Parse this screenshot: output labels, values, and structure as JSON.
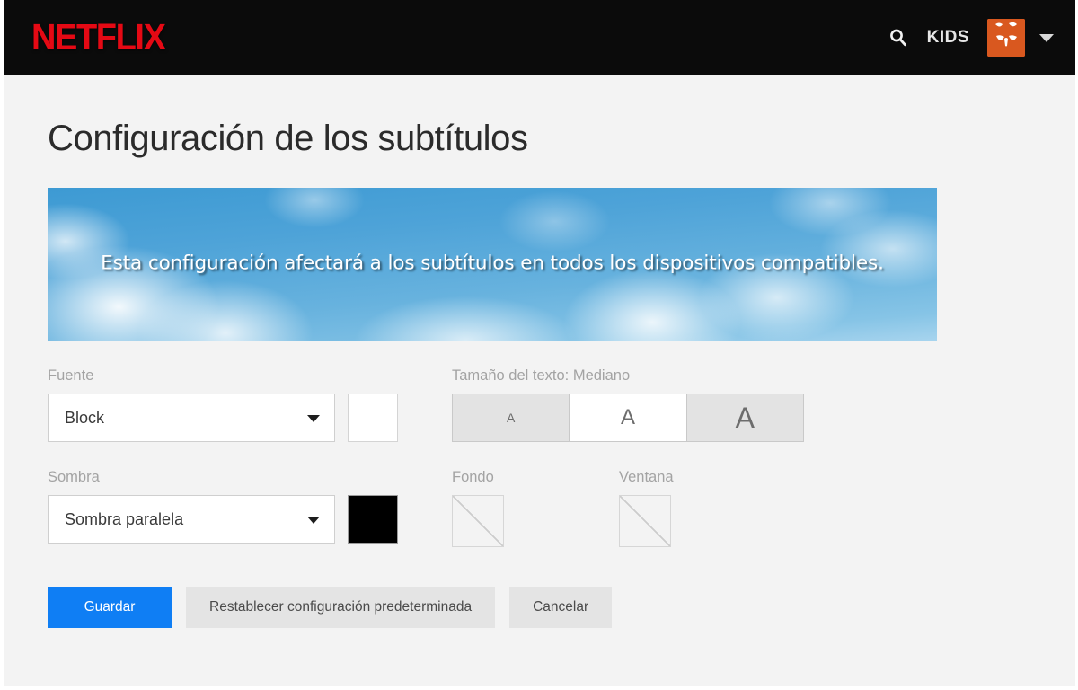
{
  "header": {
    "logo": "NETFLIX",
    "search_icon": "search-icon",
    "kids_label": "KIDS",
    "avatar_icon": "kids-avatar",
    "avatar_color": "#d9581f",
    "caret_icon": "chevron-down-icon",
    "background": "#0b0b0b",
    "logo_color": "#e50914"
  },
  "page": {
    "title": "Configuración de los subtítulos",
    "background": "#f3f3f3"
  },
  "preview": {
    "text": "Esta configuración afectará a los subtítulos en todos los dispositivos compatibles."
  },
  "font_field": {
    "label": "Fuente",
    "value": "Block",
    "swatch_color": "#ffffff",
    "arrow_icon": "chevron-down-icon"
  },
  "text_size": {
    "label": "Tamaño del texto: Mediano",
    "selected": "Mediano",
    "options": [
      {
        "label": "A",
        "size_name": "Pequeño",
        "selected": false
      },
      {
        "label": "A",
        "size_name": "Mediano",
        "selected": true
      },
      {
        "label": "A",
        "size_name": "Grande",
        "selected": false
      }
    ]
  },
  "shadow_field": {
    "label": "Sombra",
    "value": "Sombra paralela",
    "swatch_color": "#000000",
    "arrow_icon": "chevron-down-icon"
  },
  "background_field": {
    "label": "Fondo",
    "swatch_color": "transparent"
  },
  "window_field": {
    "label": "Ventana",
    "swatch_color": "transparent"
  },
  "buttons": {
    "save": "Guardar",
    "reset": "Restablecer configuración predeterminada",
    "cancel": "Cancelar",
    "save_color": "#0f7ef4"
  }
}
